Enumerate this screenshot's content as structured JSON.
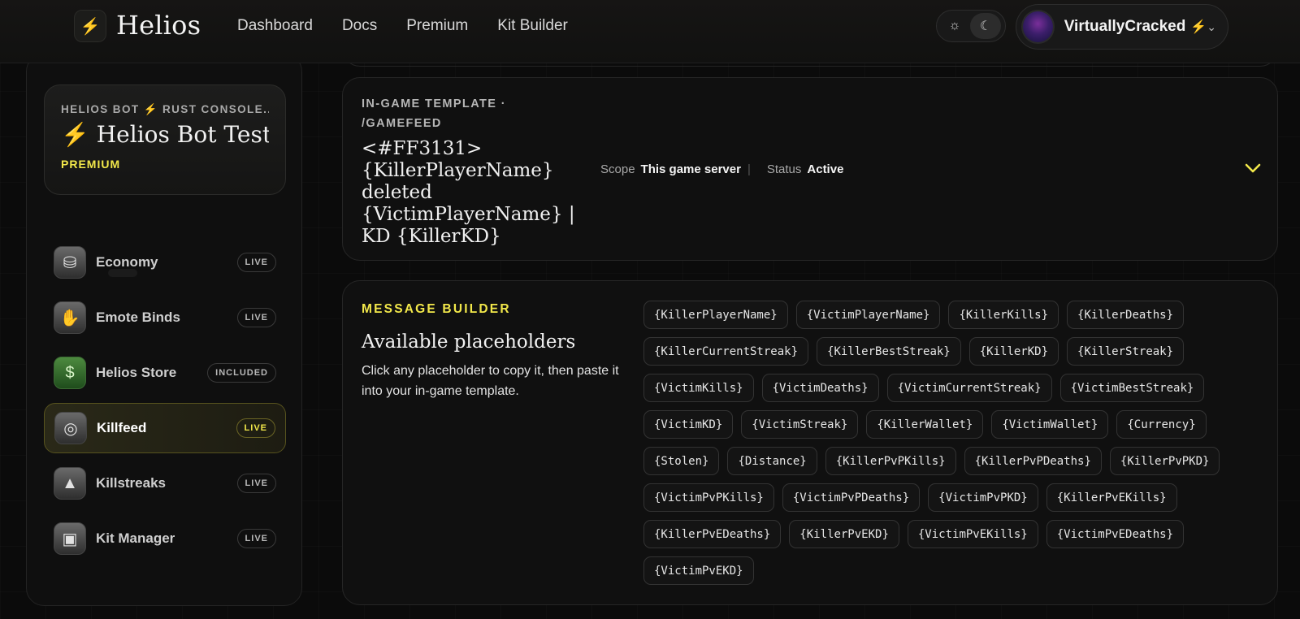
{
  "header": {
    "logo_glyph": "⚡",
    "brand": "Helios",
    "nav": [
      "Dashboard",
      "Docs",
      "Premium",
      "Kit Builder"
    ],
    "user": {
      "name": "VirtuallyCracked",
      "bolt": "⚡"
    }
  },
  "sidebar": {
    "server": {
      "kicker": "HELIOS BOT ⚡ RUST CONSOLE...",
      "name": "⚡ Helios Bot Test...",
      "tier": "PREMIUM"
    },
    "items": [
      {
        "label": "Economy",
        "badge": "LIVE",
        "icon": "coin-stack-icon"
      },
      {
        "label": "Emote Binds",
        "badge": "LIVE",
        "icon": "hand-icon"
      },
      {
        "label": "Helios Store",
        "badge": "INCLUDED",
        "icon": "dollar-icon"
      },
      {
        "label": "Killfeed",
        "badge": "LIVE",
        "icon": "skull-ring-icon"
      },
      {
        "label": "Killstreaks",
        "badge": "LIVE",
        "icon": "rocket-icon"
      },
      {
        "label": "Kit Manager",
        "badge": "LIVE",
        "icon": "toolbox-icon"
      }
    ],
    "active_item": "Killfeed"
  },
  "template": {
    "kicker": "IN-GAME TEMPLATE · /GAMEFEED",
    "text": "<#FF3131> {KillerPlayerName} deleted {VictimPlayerName} | KD {KillerKD}",
    "scope_label": "Scope",
    "scope_value": "This game server",
    "status_label": "Status",
    "status_value": "Active"
  },
  "builder": {
    "kicker": "MESSAGE BUILDER",
    "title": "Available placeholders",
    "description": "Click any placeholder to copy it, then paste it into your in-game template.",
    "placeholders": [
      "{KillerPlayerName}",
      "{VictimPlayerName}",
      "{KillerKills}",
      "{KillerDeaths}",
      "{KillerCurrentStreak}",
      "{KillerBestStreak}",
      "{KillerKD}",
      "{KillerStreak}",
      "{VictimKills}",
      "{VictimDeaths}",
      "{VictimCurrentStreak}",
      "{VictimBestStreak}",
      "{VictimKD}",
      "{VictimStreak}",
      "{KillerWallet}",
      "{VictimWallet}",
      "{Currency}",
      "{Stolen}",
      "{Distance}",
      "{KillerPvPKills}",
      "{KillerPvPDeaths}",
      "{KillerPvPKD}",
      "{VictimPvPKills}",
      "{VictimPvPDeaths}",
      "{VictimPvPKD}",
      "{KillerPvEKills}",
      "{KillerPvEDeaths}",
      "{KillerPvEKD}",
      "{VictimPvEKills}",
      "{VictimPvEDeaths}",
      "{VictimPvEKD}"
    ]
  },
  "colors": {
    "accent": "#f2e84a",
    "background": "#0b0b0b"
  }
}
